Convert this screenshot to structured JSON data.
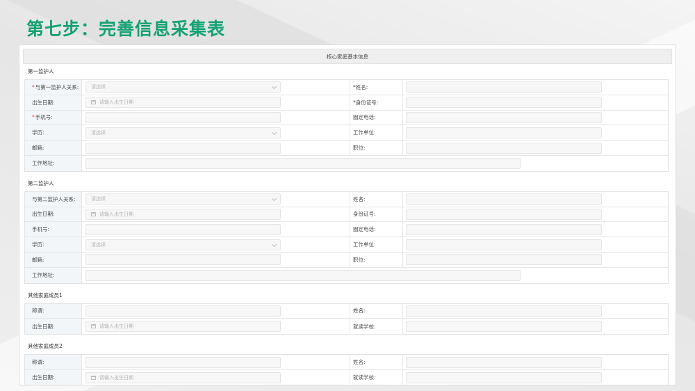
{
  "slide_title": "第七步：完善信息采集表",
  "panel_header": "核心家庭基本信息",
  "sections": [
    {
      "title": "第一监护人",
      "rows": [
        {
          "label": "与第一监护人关系:",
          "required": true,
          "type": "select",
          "placeholder": "请选择",
          "label2": "姓名:",
          "required2": true
        },
        {
          "label": "出生日期:",
          "required": false,
          "type": "date",
          "placeholder": "请输入出生日期",
          "label2": "身份证号:",
          "required2": true
        },
        {
          "label": "手机号:",
          "required": true,
          "type": "text",
          "placeholder": "",
          "label2": "固定电话:",
          "required2": false
        },
        {
          "label": "学历:",
          "required": false,
          "type": "select",
          "placeholder": "请选择",
          "label2": "工作单位:",
          "required2": false
        },
        {
          "label": "邮箱:",
          "required": false,
          "type": "text",
          "placeholder": "",
          "label2": "职位:",
          "required2": false
        },
        {
          "label": "工作地址:",
          "required": false,
          "type": "wide",
          "placeholder": ""
        }
      ]
    },
    {
      "title": "第二监护人",
      "rows": [
        {
          "label": "与第二监护人关系:",
          "required": false,
          "type": "select",
          "placeholder": "请选择",
          "label2": "姓名:",
          "required2": false
        },
        {
          "label": "出生日期:",
          "required": false,
          "type": "date",
          "placeholder": "请输入出生日期",
          "label2": "身份证号:",
          "required2": false
        },
        {
          "label": "手机号:",
          "required": false,
          "type": "text",
          "placeholder": "",
          "label2": "固定电话:",
          "required2": false
        },
        {
          "label": "学历:",
          "required": false,
          "type": "select",
          "placeholder": "请选择",
          "label2": "工作单位:",
          "required2": false
        },
        {
          "label": "邮箱:",
          "required": false,
          "type": "text",
          "placeholder": "",
          "label2": "职位:",
          "required2": false
        },
        {
          "label": "工作地址:",
          "required": false,
          "type": "wide",
          "placeholder": ""
        }
      ]
    },
    {
      "title": "其他家庭成员1",
      "rows": [
        {
          "label": "称谓:",
          "required": false,
          "type": "text",
          "placeholder": "",
          "label2": "姓名:",
          "required2": false
        },
        {
          "label": "出生日期:",
          "required": false,
          "type": "date",
          "placeholder": "请输入出生日期",
          "label2": "就读学校:",
          "required2": false
        }
      ]
    },
    {
      "title": "其他家庭成员2",
      "rows": [
        {
          "label": "称谓:",
          "required": false,
          "type": "text",
          "placeholder": "",
          "label2": "姓名:",
          "required2": false
        },
        {
          "label": "出生日期:",
          "required": false,
          "type": "date",
          "placeholder": "请输入出生日期",
          "label2": "就读学校:",
          "required2": false
        }
      ]
    }
  ]
}
